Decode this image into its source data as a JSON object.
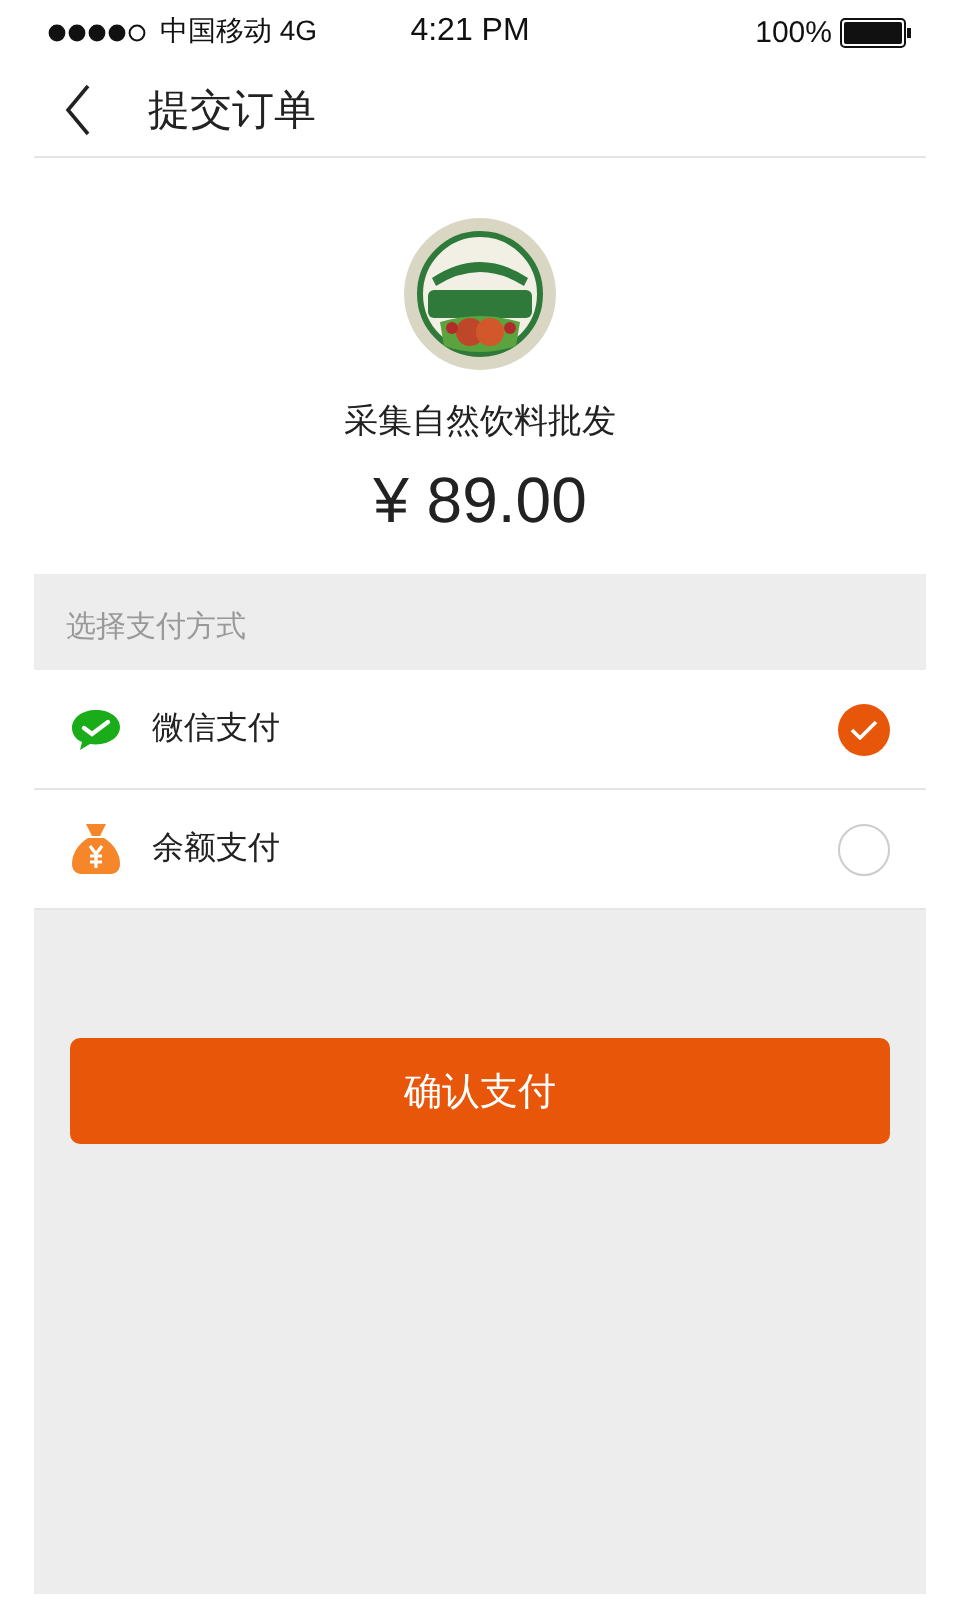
{
  "status_bar": {
    "carrier": "中国移动 4G",
    "time": "4:21 PM",
    "battery": "100%"
  },
  "nav": {
    "title": "提交订单"
  },
  "merchant": {
    "name": "采集自然饮料批发",
    "price": "¥ 89.00"
  },
  "payment": {
    "heading": "选择支付方式",
    "methods": [
      {
        "kind": "wechat",
        "label": "微信支付",
        "selected": true
      },
      {
        "kind": "balance",
        "label": "余额支付",
        "selected": false
      }
    ]
  },
  "confirm_button": "确认支付"
}
